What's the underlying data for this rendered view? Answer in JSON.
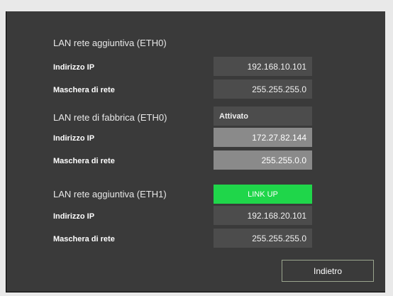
{
  "sections": [
    {
      "title": "LAN rete aggiuntiva (ETH0)",
      "ip_label": "Indirizzo IP",
      "ip_value": "192.168.10.101",
      "mask_label": "Maschera di rete",
      "mask_value": "255.255.255.0"
    },
    {
      "title": "LAN rete di fabbrica (ETH0)",
      "status": "Attivato",
      "ip_label": "Indirizzo IP",
      "ip_value": "172.27.82.144",
      "mask_label": "Maschera di rete",
      "mask_value": "255.255.0.0"
    },
    {
      "title": "LAN rete aggiuntiva (ETH1)",
      "status": "LINK UP",
      "ip_label": "Indirizzo IP",
      "ip_value": "192.168.20.101",
      "mask_label": "Maschera di rete",
      "mask_value": "255.255.255.0"
    }
  ],
  "footer": {
    "back_label": "Indietro"
  },
  "colors": {
    "panel": "#3a3a3a",
    "field": "#4c4c4c",
    "field_active": "#8a8a8a",
    "link_up": "#1fd64a",
    "button_border": "#9aa58e"
  }
}
